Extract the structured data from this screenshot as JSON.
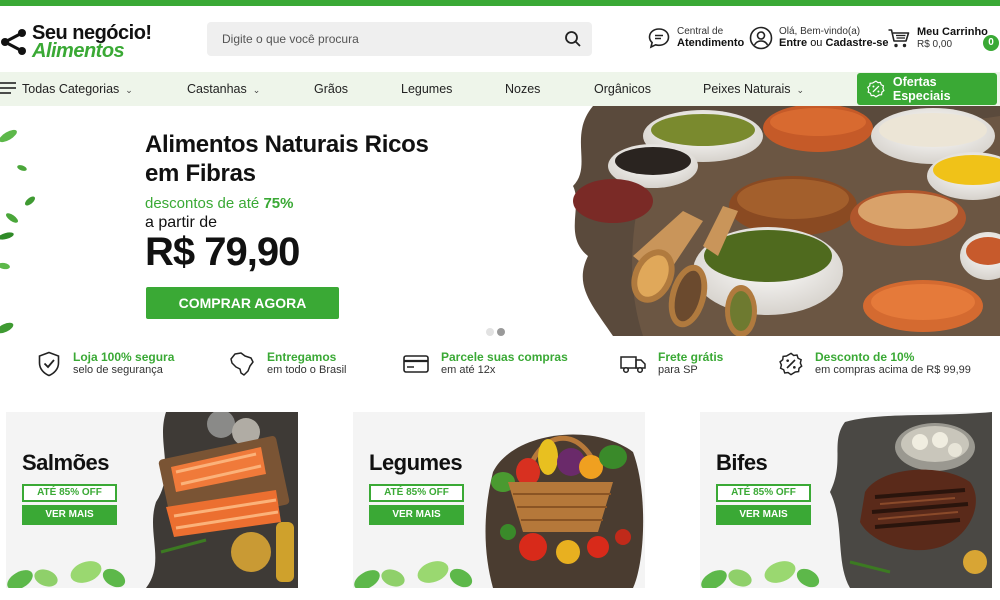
{
  "brand": {
    "line1": "Seu negócio!",
    "line2": "Alimentos",
    "accent": "#3aa935"
  },
  "search": {
    "placeholder": "Digite o que você procura",
    "icon": "search-icon"
  },
  "header": {
    "support": {
      "small": "Central de",
      "big": "Atendimento",
      "icon": "chat-icon"
    },
    "account": {
      "small": "Olá, Bem-vindo(a)",
      "login": "Entre",
      "or": "ou",
      "signup": "Cadastre-se",
      "icon": "user-icon"
    },
    "cart": {
      "label": "Meu Carrinho",
      "total": "R$ 0,00",
      "count": "0",
      "icon": "cart-icon"
    }
  },
  "nav": {
    "all": "Todas Categorias",
    "items": [
      "Castanhas",
      "Grãos",
      "Legumes",
      "Nozes",
      "Orgânicos",
      "Peixes Naturais"
    ],
    "offers": "Ofertas Especiais"
  },
  "hero": {
    "title_l1": "Alimentos Naturais Ricos",
    "title_l2": "em Fibras",
    "discount_prefix": "descontos de até",
    "discount_value": "75%",
    "from": "a partir de",
    "price": "R$ 79,90",
    "cta": "COMPRAR AGORA",
    "slide_count": 2,
    "active_slide": 2
  },
  "features": [
    {
      "title": "Loja 100% segura",
      "sub": "selo de segurança",
      "icon": "shield-check-icon"
    },
    {
      "title": "Entregamos",
      "sub": "em todo o Brasil",
      "icon": "brazil-map-icon"
    },
    {
      "title": "Parcele suas compras",
      "sub": "em até 12x",
      "icon": "credit-card-icon"
    },
    {
      "title": "Frete grátis",
      "sub": "para SP",
      "icon": "truck-icon"
    },
    {
      "title": "Desconto de 10%",
      "sub": "em compras acima de R$ 99,99",
      "icon": "percent-badge-icon"
    }
  ],
  "cards": [
    {
      "title": "Salmões",
      "off": "ATÉ 85% OFF",
      "cta": "VER MAIS"
    },
    {
      "title": "Legumes",
      "off": "ATÉ 85% OFF",
      "cta": "VER MAIS"
    },
    {
      "title": "Bifes",
      "off": "ATÉ 85% OFF",
      "cta": "VER MAIS"
    }
  ]
}
